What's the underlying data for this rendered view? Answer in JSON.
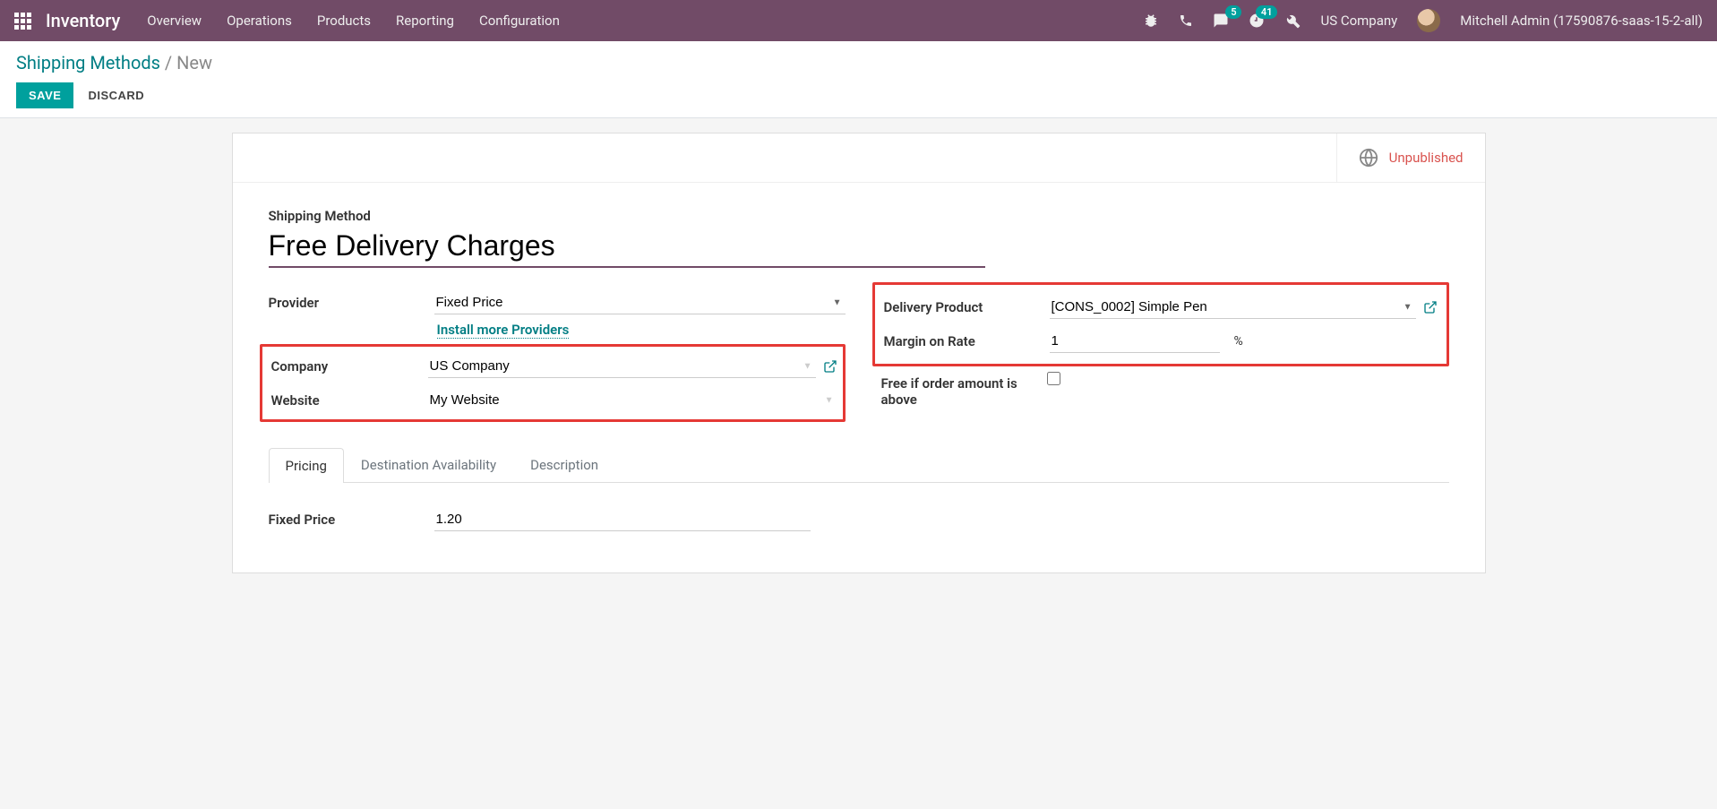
{
  "topbar": {
    "app_title": "Inventory",
    "menu": [
      "Overview",
      "Operations",
      "Products",
      "Reporting",
      "Configuration"
    ],
    "badge_messages": "5",
    "badge_activities": "41",
    "company": "US Company",
    "user": "Mitchell Admin (17590876-saas-15-2-all)"
  },
  "breadcrumb": {
    "parent": "Shipping Methods",
    "current": "New"
  },
  "buttons": {
    "save": "SAVE",
    "discard": "DISCARD"
  },
  "publish": {
    "status": "Unpublished"
  },
  "form": {
    "title_label": "Shipping Method",
    "title_value": "Free Delivery Charges",
    "left": {
      "provider_label": "Provider",
      "provider_value": "Fixed Price",
      "install_link": "Install more Providers",
      "company_label": "Company",
      "company_value": "US Company",
      "website_label": "Website",
      "website_value": "My Website"
    },
    "right": {
      "delivery_product_label": "Delivery Product",
      "delivery_product_value": "[CONS_0002] Simple Pen",
      "margin_label": "Margin on Rate",
      "margin_value": "1",
      "margin_unit": "%",
      "free_if_label": "Free if order amount is above"
    }
  },
  "tabs": {
    "pricing": "Pricing",
    "destination": "Destination Availability",
    "description": "Description"
  },
  "pricing_tab": {
    "fixed_price_label": "Fixed Price",
    "fixed_price_value": "1.20"
  }
}
